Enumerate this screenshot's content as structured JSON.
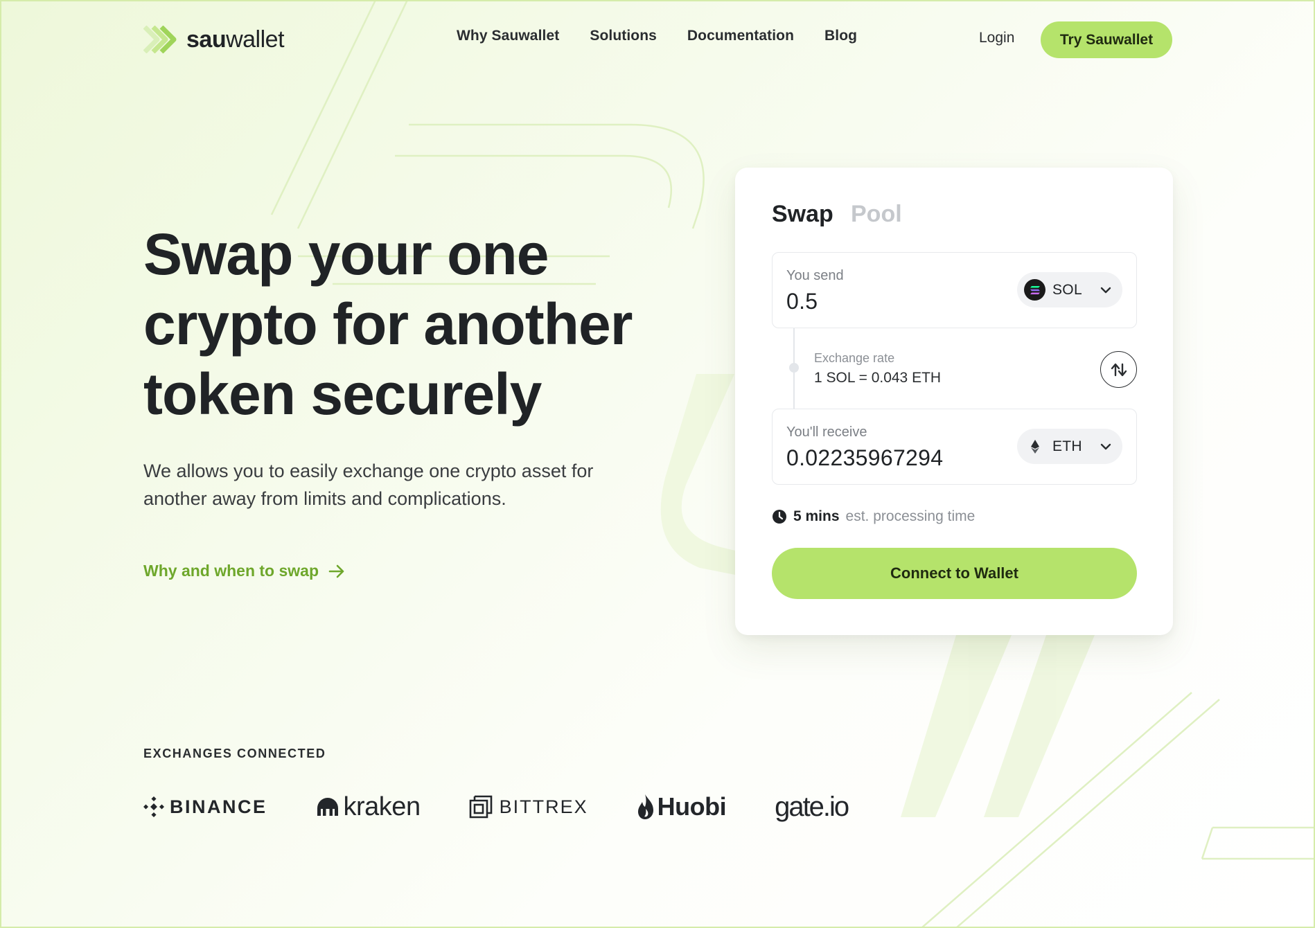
{
  "brand": {
    "name_bold": "sau",
    "name_rest": "wallet",
    "accent_color": "#b5e36b",
    "link_color": "#6ea72b"
  },
  "nav": {
    "items": [
      "Why Sauwallet",
      "Solutions",
      "Documentation",
      "Blog"
    ],
    "login": "Login",
    "cta": "Try Sauwallet"
  },
  "hero": {
    "title": "Swap your one crypto for another token securely",
    "description": "We allows you to easily exchange one crypto asset for another away from limits and complications.",
    "link": "Why and when to swap"
  },
  "swap_card": {
    "tabs": [
      "Swap",
      "Pool"
    ],
    "active_tab": "Swap",
    "send": {
      "label": "You send",
      "value": "0.5",
      "token": "SOL",
      "icon": "solana-icon"
    },
    "rate": {
      "label": "Exchange rate",
      "value": "1 SOL = 0.043 ETH"
    },
    "receive": {
      "label": "You'll receive",
      "value": "0.02235967294",
      "token": "ETH",
      "icon": "ethereum-icon"
    },
    "eta": {
      "strong": "5 mins",
      "rest": "est. processing time"
    },
    "button": "Connect to Wallet"
  },
  "exchanges": {
    "label": "EXCHANGES CONNECTED",
    "items": [
      "BINANCE",
      "kraken",
      "BITTREX",
      "Huobi",
      "gate.io"
    ]
  }
}
